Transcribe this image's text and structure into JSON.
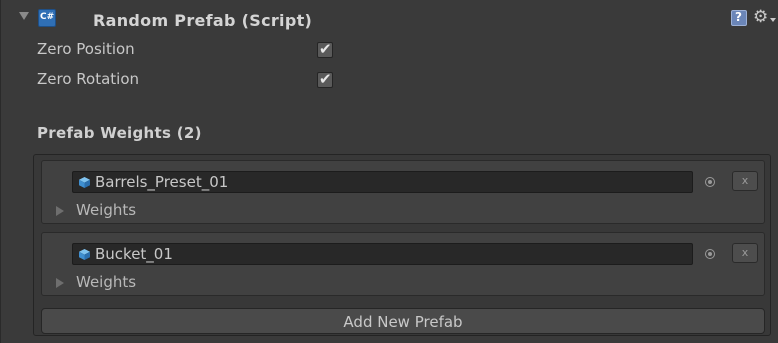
{
  "component": {
    "title": "Random Prefab (Script)",
    "icons": {
      "foldout": "foldout-expanded-icon",
      "script": "csharp-script-icon",
      "help": "help-icon",
      "settings": "gear-icon"
    }
  },
  "fields": [
    {
      "label": "Zero Position",
      "checked": true
    },
    {
      "label": "Zero Rotation",
      "checked": true
    }
  ],
  "prefab_weights": {
    "title": "Prefab Weights (2)",
    "items": [
      {
        "object": "Barrels_Preset_01",
        "weights_label": "Weights",
        "remove_label": "x"
      },
      {
        "object": "Bucket_01",
        "weights_label": "Weights",
        "remove_label": "x"
      }
    ],
    "add_label": "Add New Prefab"
  },
  "colors": {
    "background": "#3a3a3a",
    "script_icon": "#2f6fb5",
    "prefab_icon": "#4aa0e0"
  }
}
